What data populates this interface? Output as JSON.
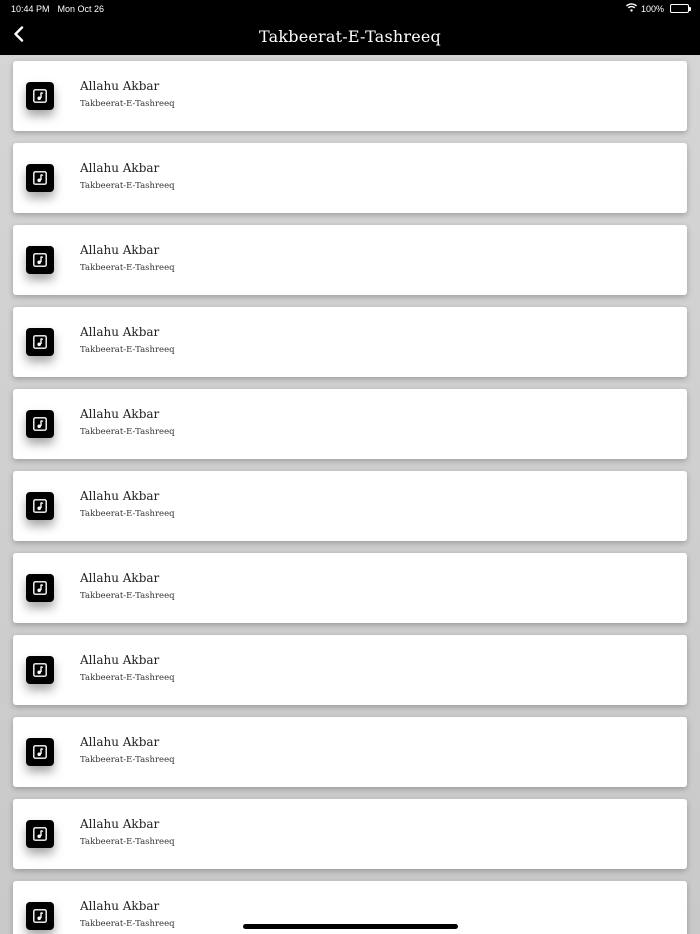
{
  "status_bar": {
    "time": "10:44 PM",
    "date": "Mon Oct 26",
    "battery": "100%",
    "icons": [
      "wifi-icon",
      "battery-icon"
    ]
  },
  "nav": {
    "title": "Takbeerat-E-Tashreeq",
    "back_icon": "chevron-left-icon"
  },
  "items": [
    {
      "title": "Allahu Akbar",
      "subtitle": "Takbeerat-E-Tashreeq"
    },
    {
      "title": "Allahu Akbar",
      "subtitle": "Takbeerat-E-Tashreeq"
    },
    {
      "title": "Allahu Akbar",
      "subtitle": "Takbeerat-E-Tashreeq"
    },
    {
      "title": "Allahu Akbar",
      "subtitle": "Takbeerat-E-Tashreeq"
    },
    {
      "title": "Allahu Akbar",
      "subtitle": "Takbeerat-E-Tashreeq"
    },
    {
      "title": "Allahu Akbar",
      "subtitle": "Takbeerat-E-Tashreeq"
    },
    {
      "title": "Allahu Akbar",
      "subtitle": "Takbeerat-E-Tashreeq"
    },
    {
      "title": "Allahu Akbar",
      "subtitle": "Takbeerat-E-Tashreeq"
    },
    {
      "title": "Allahu Akbar",
      "subtitle": "Takbeerat-E-Tashreeq"
    },
    {
      "title": "Allahu Akbar",
      "subtitle": "Takbeerat-E-Tashreeq"
    },
    {
      "title": "Allahu Akbar",
      "subtitle": "Takbeerat-E-Tashreeq"
    }
  ],
  "item_icon": "music-note-icon",
  "colors": {
    "bar_background": "#000000",
    "card_background": "#ffffff",
    "page_background": "#cfcfcf"
  }
}
